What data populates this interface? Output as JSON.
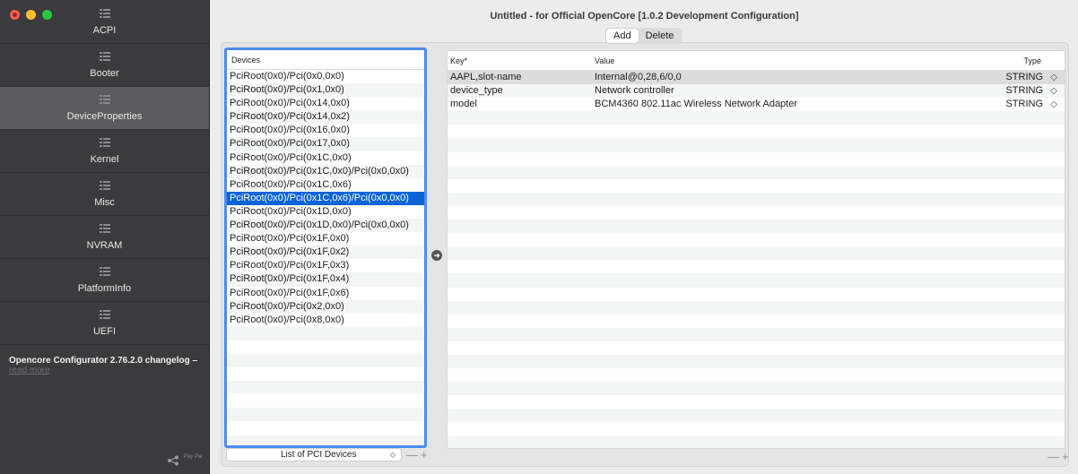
{
  "window": {
    "title": "Untitled - for Official OpenCore [1.0.2 Development Configuration]"
  },
  "sidebar": {
    "items": [
      {
        "label": "ACPI",
        "icon": "list-icon"
      },
      {
        "label": "Booter",
        "icon": "list-icon"
      },
      {
        "label": "DeviceProperties",
        "icon": "list-icon",
        "selected": true
      },
      {
        "label": "Kernel",
        "icon": "list-icon"
      },
      {
        "label": "Misc",
        "icon": "list-icon"
      },
      {
        "label": "NVRAM",
        "icon": "list-icon"
      },
      {
        "label": "PlatformInfo",
        "icon": "list-icon"
      },
      {
        "label": "UEFI",
        "icon": "list-icon"
      }
    ],
    "changelog_title": "Opencore Configurator 2.76.2.0 changelog –",
    "changelog_link": "read more",
    "footer_text": "Pay Pal"
  },
  "toolbar": {
    "add_label": "Add",
    "delete_label": "Delete"
  },
  "devices": {
    "header": "Devices",
    "rows": [
      "PciRoot(0x0)/Pci(0x0,0x0)",
      "PciRoot(0x0)/Pci(0x1,0x0)",
      "PciRoot(0x0)/Pci(0x14,0x0)",
      "PciRoot(0x0)/Pci(0x14,0x2)",
      "PciRoot(0x0)/Pci(0x16,0x0)",
      "PciRoot(0x0)/Pci(0x17,0x0)",
      "PciRoot(0x0)/Pci(0x1C,0x0)",
      "PciRoot(0x0)/Pci(0x1C,0x0)/Pci(0x0,0x0)",
      "PciRoot(0x0)/Pci(0x1C,0x6)",
      "PciRoot(0x0)/Pci(0x1C,0x6)/Pci(0x0,0x0)",
      "PciRoot(0x0)/Pci(0x1D,0x0)",
      "PciRoot(0x0)/Pci(0x1D,0x0)/Pci(0x0,0x0)",
      "PciRoot(0x0)/Pci(0x1F,0x0)",
      "PciRoot(0x0)/Pci(0x1F,0x2)",
      "PciRoot(0x0)/Pci(0x1F,0x3)",
      "PciRoot(0x0)/Pci(0x1F,0x4)",
      "PciRoot(0x0)/Pci(0x1F,0x6)",
      "PciRoot(0x0)/Pci(0x2,0x0)",
      "PciRoot(0x0)/Pci(0x8,0x0)"
    ],
    "selected_index": 9,
    "popup_label": "List of PCI Devices",
    "popup_arrows": "◇"
  },
  "properties": {
    "headers": {
      "key": "Key*",
      "value": "Value",
      "type": "Type"
    },
    "rows": [
      {
        "key": "AAPL,slot-name",
        "value": "Internal@0,28,6/0,0",
        "type": "STRING"
      },
      {
        "key": "device_type",
        "value": "Network controller",
        "type": "STRING"
      },
      {
        "key": "model",
        "value": "BCM4360 802.11ac Wireless Network Adapter",
        "type": "STRING"
      }
    ],
    "selected_index": 0,
    "chevron": "◇"
  },
  "controls": {
    "minus_plus": "—+",
    "arrow_glyph": "➜"
  },
  "colors": {
    "sidebar_bg": "#3b3b3d",
    "sidebar_selected": "#5b5b5e",
    "selection_blue": "#0a64d8",
    "focus_ring": "#4b8cf2"
  }
}
